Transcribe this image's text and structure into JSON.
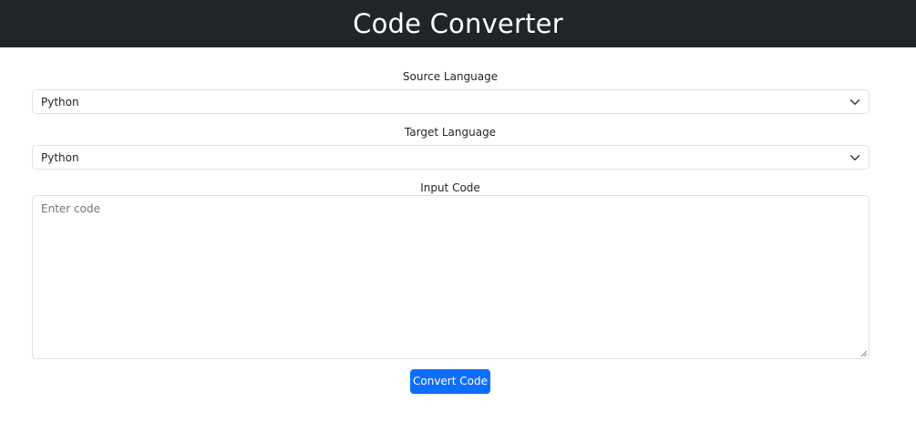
{
  "header": {
    "title": "Code Converter"
  },
  "form": {
    "source_label": "Source Language",
    "source_value": "Python",
    "target_label": "Target Language",
    "target_value": "Python",
    "input_label": "Input Code",
    "input_placeholder": "Enter code",
    "submit_label": "Convert Code"
  },
  "icons": {
    "dropdown": "chevron-down-icon",
    "resize": "resize-grip-icon"
  },
  "colors": {
    "header_bg": "#212529",
    "primary": "#0d6efd",
    "border": "#dee2e6",
    "placeholder": "#6c757d"
  }
}
